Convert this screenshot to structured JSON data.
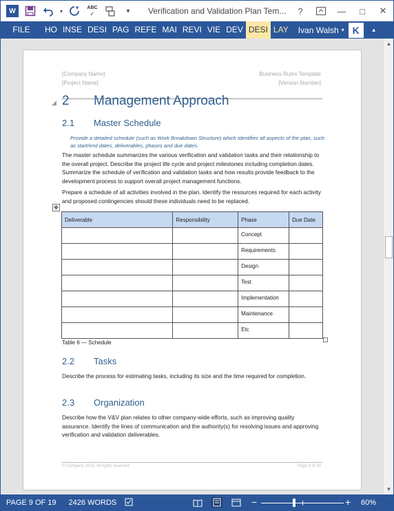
{
  "window": {
    "title": "Verification and Validation Plan Tem...",
    "help": "?",
    "ribbon_display_icon": "ribbon-display-icon",
    "minimize": "—",
    "maximize": "□",
    "close": "✕"
  },
  "qat": {
    "app_logo": "W",
    "save_icon": "save-icon",
    "undo_icon": "undo-icon",
    "redo_icon": "redo-icon",
    "spelling_label": "ABC",
    "format_painter_icon": "format-painter-icon",
    "customize_icon": "customize-qat-icon"
  },
  "ribbon": {
    "tabs": [
      "FILE",
      "HO",
      "INSE",
      "DESI",
      "PAG",
      "REFE",
      "MAI",
      "REVI",
      "VIE",
      "DEV",
      "DESI",
      "LAY"
    ],
    "user": "Ivan Walsh",
    "avatar_letter": "K",
    "accent": "#2b579a",
    "contextual_color": "#fbe8a6"
  },
  "document": {
    "header": {
      "company": "[Company Name]",
      "project": "[Project Name]",
      "template": "Business Rules Template",
      "version": "[Version Number]"
    },
    "heading1": {
      "number": "2",
      "text": "Management Approach"
    },
    "section_2_1": {
      "number": "2.1",
      "title": "Master Schedule",
      "instruction": "Provide a detailed schedule (such as Work Breakdown Structure) which identifies all aspects of the plan, such as start/end dates, deliverables, phases and due dates.",
      "para1": "The master schedule summarizes the various verification and validation tasks and their relationship to the overall project. Describe the project life cycle and project milestones including completion dates. Summarize the schedule of verification and validation tasks and how results provide feedback to the development process to support overall project management functions.",
      "para2": "Prepare a schedule of all activities involved in the plan. Identify the resources required for each activity and proposed contingencies should these individuals need to be replaced."
    },
    "table": {
      "headers": [
        "Deliverable",
        "Responsibility",
        "Phase",
        "Due Date"
      ],
      "phases": [
        "Concept",
        "Requirements",
        "Design",
        "Test",
        "Implementation",
        "Maintenance",
        "Etc"
      ],
      "caption": "Table 6 — Schedule",
      "header_bg": "#c5d9f1"
    },
    "section_2_2": {
      "number": "2.2",
      "title": "Tasks",
      "body": "Describe the process for estimating tasks, including its size and the time required for completion."
    },
    "section_2_3": {
      "number": "2.3",
      "title": "Organization",
      "body": "Describe how the V&V plan relates to other company-wide efforts, such as improving quality assurance. Identify the lines of communication and the authority(s) for resolving issues and approving verification and validation deliverables."
    },
    "footer": {
      "copyright": "© Company 2016. All rights reserved.",
      "page": "Page 9 of 19"
    }
  },
  "statusbar": {
    "page": "PAGE 9 OF 19",
    "words": "2426 WORDS",
    "proofing_icon": "proofing-icon",
    "zoom_minus": "−",
    "zoom_plus": "+",
    "zoom": "60%"
  }
}
